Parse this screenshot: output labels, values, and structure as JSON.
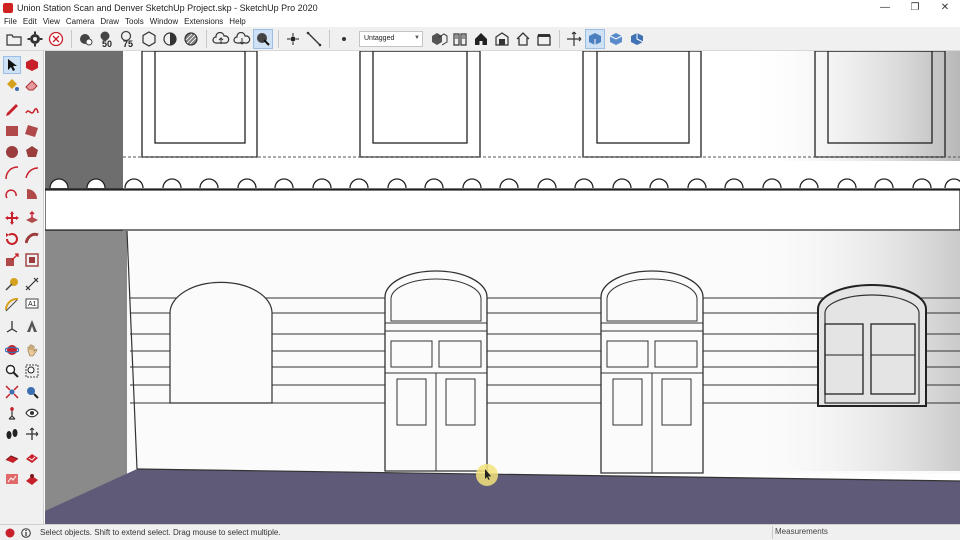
{
  "window": {
    "title": "Union Station Scan and Denver SketchUp Project.skp - SketchUp Pro 2020",
    "minimize": "—",
    "restore": "❐",
    "close": "✕"
  },
  "menu": {
    "items": [
      "File",
      "Edit",
      "View",
      "Camera",
      "Draw",
      "Tools",
      "Window",
      "Extensions",
      "Help"
    ]
  },
  "toolbar": {
    "tag_selected": "Untagged",
    "zoom_badges": [
      "50",
      "75"
    ]
  },
  "status": {
    "hint": "Select objects. Shift to extend select. Drag mouse to select multiple.",
    "measurements_label": "Measurements"
  },
  "colors": {
    "ground": "#5e5a77",
    "shadow_wall": "#6e6e6e",
    "accent_red": "#c8202a",
    "highlight": "#cfe1f5"
  }
}
